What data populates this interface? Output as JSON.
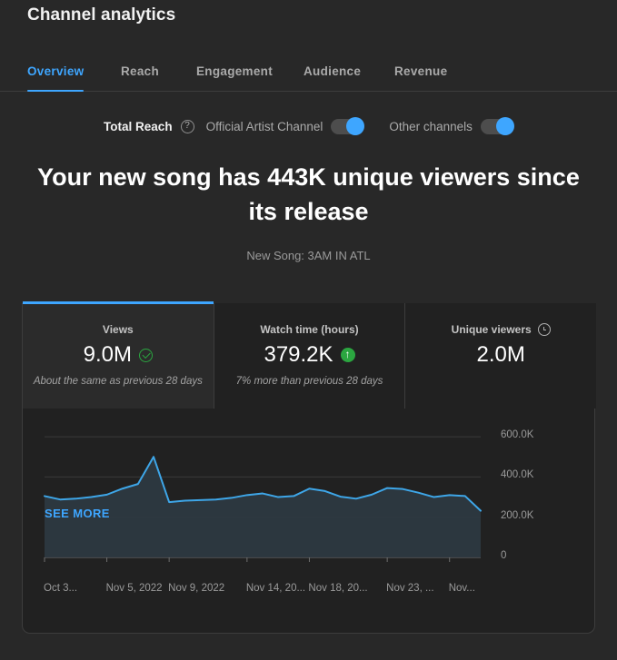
{
  "header": {
    "title": "Channel analytics"
  },
  "tabs": [
    {
      "label": "Overview",
      "active": true,
      "x": 30
    },
    {
      "label": "Reach",
      "active": false,
      "x": 133
    },
    {
      "label": "Engagement",
      "active": false,
      "x": 216
    },
    {
      "label": "Audience",
      "active": false,
      "x": 334
    },
    {
      "label": "Revenue",
      "active": false,
      "x": 434
    }
  ],
  "toggle_row": {
    "label": "Total Reach",
    "help_icon": "help-circle-icon",
    "help_glyph": "?",
    "toggles": [
      {
        "label": "Official Artist Channel",
        "on": true
      },
      {
        "label": "Other channels",
        "on": true
      }
    ]
  },
  "highlight": {
    "headline": "Your new song has 443K unique viewers since its release",
    "subhead": "New Song: 3AM IN ATL"
  },
  "metrics": [
    {
      "title": "Views",
      "value": "9.0M",
      "subtitle": "About the same as previous 28 days",
      "status_icon": "check-circle-icon",
      "title_icon": "",
      "selected": true
    },
    {
      "title": "Watch time (hours)",
      "value": "379.2K",
      "subtitle": "7% more than previous 28 days",
      "status_icon": "arrow-up-circle-icon",
      "title_icon": "",
      "selected": false
    },
    {
      "title": "Unique viewers",
      "value": "2.0M",
      "subtitle": "",
      "status_icon": "",
      "title_icon": "clock-icon",
      "selected": false
    }
  ],
  "see_more_label": "SEE MORE",
  "colors": {
    "accent": "#3ea6ff",
    "positive": "#2ba640",
    "background": "#282828",
    "panel": "#212121",
    "line": "#3ea6e8",
    "area": "#2e3a42"
  },
  "chart_data": {
    "type": "area",
    "title": "",
    "xlabel": "",
    "ylabel": "",
    "ylim": [
      0,
      650000
    ],
    "grid": true,
    "legend": "none",
    "y_ticks": [
      {
        "value": 600000,
        "label": "600.0K"
      },
      {
        "value": 400000,
        "label": "400.0K"
      },
      {
        "value": 200000,
        "label": "200.0K"
      },
      {
        "value": 0,
        "label": "0"
      }
    ],
    "x_tick_labels": [
      {
        "label": "Oct 3...",
        "index": 0
      },
      {
        "label": "Nov 5, 2022",
        "index": 4
      },
      {
        "label": "Nov 9, 2022",
        "index": 8
      },
      {
        "label": "Nov 14, 20...",
        "index": 13
      },
      {
        "label": "Nov 18, 20...",
        "index": 17
      },
      {
        "label": "Nov 23, ...",
        "index": 22
      },
      {
        "label": "Nov...",
        "index": 26
      }
    ],
    "series": [
      {
        "name": "Views",
        "values": [
          305000,
          288000,
          292000,
          300000,
          312000,
          342000,
          365000,
          500000,
          275000,
          282000,
          285000,
          288000,
          296000,
          310000,
          318000,
          300000,
          305000,
          342000,
          330000,
          302000,
          292000,
          312000,
          345000,
          340000,
          322000,
          300000,
          310000,
          305000,
          232000
        ]
      }
    ]
  }
}
